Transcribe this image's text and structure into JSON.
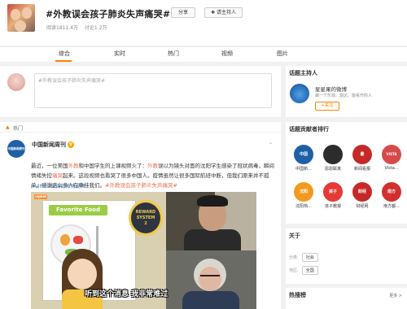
{
  "topic": {
    "title": "#外教误会孩子肺炎失声痛哭#",
    "share_label": "分享",
    "host_label": "请主持人",
    "host_icon": "pin-icon",
    "reads": "阅读1811.4万",
    "discussions": "讨论1.2万"
  },
  "tabs": [
    {
      "label": "综合",
      "active": true
    },
    {
      "label": "实时",
      "active": false
    },
    {
      "label": "热门",
      "active": false
    },
    {
      "label": "视频",
      "active": false
    },
    {
      "label": "图片",
      "active": false
    }
  ],
  "composer": {
    "placeholder": "#外教误会孩子肺炎失声痛哭#"
  },
  "hot_section": {
    "label": "热门"
  },
  "post": {
    "author": "中国新闻周刊",
    "avatar_text": "中国新闻周刊",
    "body_parts": [
      {
        "text": "最近，一位美国",
        "hl": false
      },
      {
        "text": "外教",
        "hl": true
      },
      {
        "text": "和中国学生的上课视频火了：",
        "hl": false
      },
      {
        "text": "外教",
        "hl": true
      },
      {
        "text": "误以为镜头对面的沈阳学生感染了冠状病毒，瞬间情绪失控",
        "hl": false
      },
      {
        "text": "痛哭",
        "hl": true
      },
      {
        "text": "起来。这段视频也看哭了很多中国人。疫情虽然让很多国际航班中断，但我们原来并不孤单，感谢这么多人在牵挂我们。",
        "hl": false
      },
      {
        "text": "#外教误会孩子肺炎失声痛哭#",
        "hl": true
      }
    ],
    "video_link": "VIPKID官微的微博视频",
    "video": {
      "brand_tag": "vipkid",
      "slide_title": "Favorite Food",
      "reward_line1": "REWARD",
      "reward_line2": "SYSTEM",
      "reward_line3": "2",
      "subtitle": "听到这个消息 我非常难过"
    }
  },
  "sidebar": {
    "host": {
      "heading": "话题主持人",
      "name": "星星果的微博",
      "desc": "做一个乐观、豁达、能看开的人",
      "follow_label": "+关注"
    },
    "contributors": {
      "heading": "话题贡献者排行",
      "items": [
        {
          "name": "中国新...",
          "avatar_text": "中国",
          "color": "#1f5fa8"
        },
        {
          "name": "恩恩联真",
          "avatar_text": "",
          "color": "#2c2c2c"
        },
        {
          "name": "新闻看报",
          "avatar_text": "最",
          "color": "#c62828"
        },
        {
          "name": "Vista...",
          "avatar_text": "VISTA",
          "color": "#d84a4a"
        },
        {
          "name": "沈阳热...",
          "avatar_text": "沈阳",
          "color": "#f39a1e"
        },
        {
          "name": "孩子教报",
          "avatar_text": "孩子",
          "color": "#e53935"
        },
        {
          "name": "财经网",
          "avatar_text": "财经",
          "color": "#c62828"
        },
        {
          "name": "南方都...",
          "avatar_text": "南方",
          "color": "#d32f2f"
        }
      ]
    },
    "about": {
      "heading": "关于",
      "category_label": "分类:",
      "category_value": "社会",
      "region_label": "地区:",
      "region_value": "全国"
    },
    "hotlist": {
      "heading": "热搜榜",
      "more_label": "更多 >"
    }
  }
}
